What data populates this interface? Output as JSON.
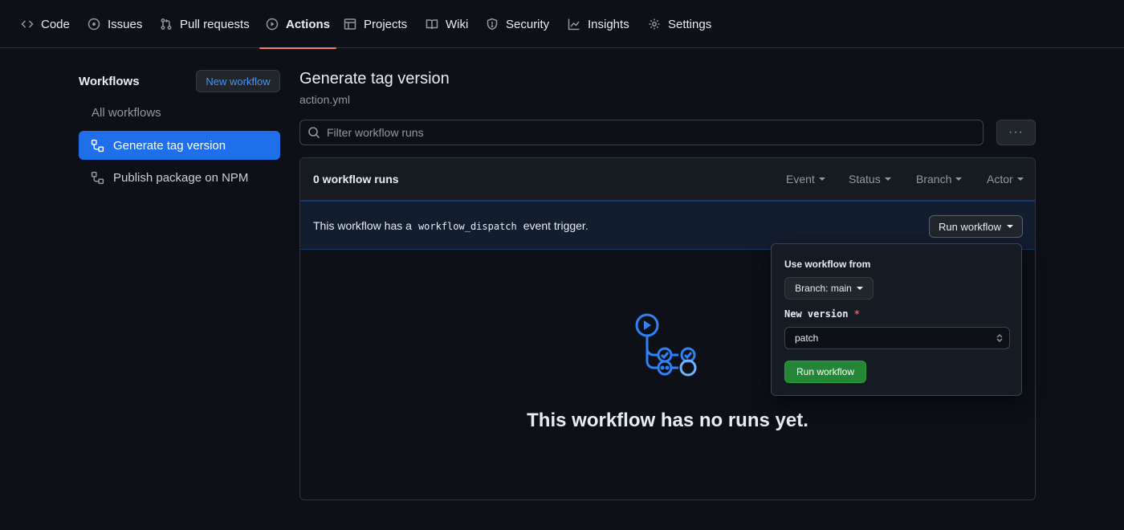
{
  "nav": {
    "tabs": [
      {
        "label": "Code",
        "icon": "code-icon"
      },
      {
        "label": "Issues",
        "icon": "issue-icon"
      },
      {
        "label": "Pull requests",
        "icon": "pull-request-icon"
      },
      {
        "label": "Actions",
        "icon": "play-icon",
        "active": true
      },
      {
        "label": "Projects",
        "icon": "table-icon"
      },
      {
        "label": "Wiki",
        "icon": "book-icon"
      },
      {
        "label": "Security",
        "icon": "shield-icon"
      },
      {
        "label": "Insights",
        "icon": "graph-icon"
      },
      {
        "label": "Settings",
        "icon": "gear-icon"
      }
    ],
    "active_underline_color": "#f78166"
  },
  "sidebar": {
    "title": "Workflows",
    "new_workflow_label": "New workflow",
    "all_workflows_label": "All workflows",
    "items": [
      {
        "label": "Generate tag version",
        "icon": "workflow-icon",
        "active": true
      },
      {
        "label": "Publish package on NPM",
        "icon": "workflow-icon",
        "active": false
      }
    ]
  },
  "main": {
    "title": "Generate tag version",
    "subtitle": "action.yml",
    "filter_placeholder": "Filter workflow runs",
    "more_label": "···",
    "runs_count": "0 workflow runs",
    "filters": [
      "Event",
      "Status",
      "Branch",
      "Actor"
    ],
    "dispatch_before": "This workflow has a",
    "dispatch_code": "workflow_dispatch",
    "dispatch_after": "event trigger.",
    "run_workflow_label": "Run workflow",
    "empty_text": "This workflow has no runs yet."
  },
  "popover": {
    "use_from_label": "Use workflow from",
    "branch_label": "Branch: main",
    "input_label": "New version",
    "required_marker": "*",
    "input_value": "patch",
    "submit_label": "Run workflow"
  },
  "colors": {
    "accent_blue": "#1f6feb",
    "link_blue": "#4493f8",
    "run_green": "#238636",
    "background": "#0d1117"
  }
}
